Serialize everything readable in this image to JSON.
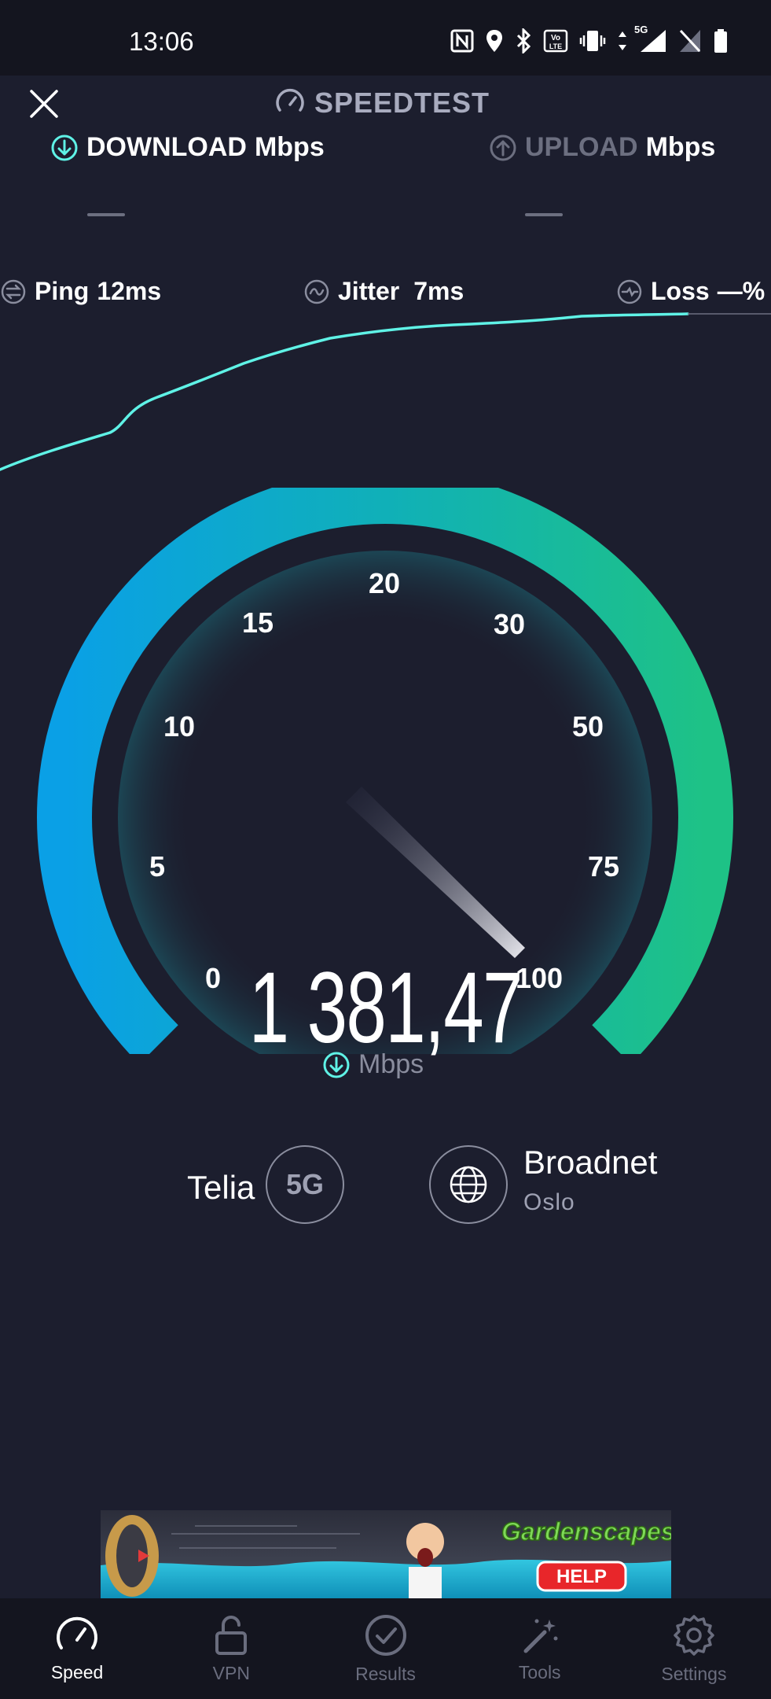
{
  "status_bar": {
    "time": "13:06",
    "network_label": "5G",
    "icons": [
      "nfc-icon",
      "location-icon",
      "bluetooth-icon",
      "volte-icon",
      "vibrate-icon",
      "data-arrows-icon",
      "signal-icon",
      "no-sim-icon",
      "battery-icon"
    ]
  },
  "header": {
    "title": "SPEEDTEST",
    "close_icon": "close-icon"
  },
  "download": {
    "label": "DOWNLOAD",
    "unit": "Mbps",
    "value": "—"
  },
  "upload": {
    "label": "UPLOAD",
    "unit": "Mbps",
    "value": "—"
  },
  "metrics": {
    "ping_label": "Ping",
    "ping_value": "12ms",
    "jitter_label": "Jitter",
    "jitter_value": "7ms",
    "loss_label": "Loss",
    "loss_value": "—%"
  },
  "gauge": {
    "ticks": [
      "0",
      "5",
      "10",
      "15",
      "20",
      "30",
      "50",
      "75",
      "100"
    ],
    "current_speed": "1 381,47",
    "unit": "Mbps",
    "needle_scale_value": 100
  },
  "connection": {
    "provider": "Telia",
    "network_type": "5G",
    "server_name": "Broadnet",
    "server_location": "Oslo"
  },
  "ad": {
    "brand": "Gardenscapes",
    "cta": "HELP"
  },
  "nav": {
    "items": [
      {
        "label": "Speed",
        "icon": "speedometer-icon",
        "active": true
      },
      {
        "label": "VPN",
        "icon": "lock-icon",
        "active": false
      },
      {
        "label": "Results",
        "icon": "check-circle-icon",
        "active": false
      },
      {
        "label": "Tools",
        "icon": "magic-wand-icon",
        "active": false
      },
      {
        "label": "Settings",
        "icon": "gear-icon",
        "active": false
      }
    ]
  },
  "colors": {
    "background": "#1c1e2e",
    "accent_cyan": "#5ff2e6",
    "gauge_start": "#0aa0e6",
    "gauge_end": "#1ec286",
    "muted": "#8a8d9e"
  }
}
